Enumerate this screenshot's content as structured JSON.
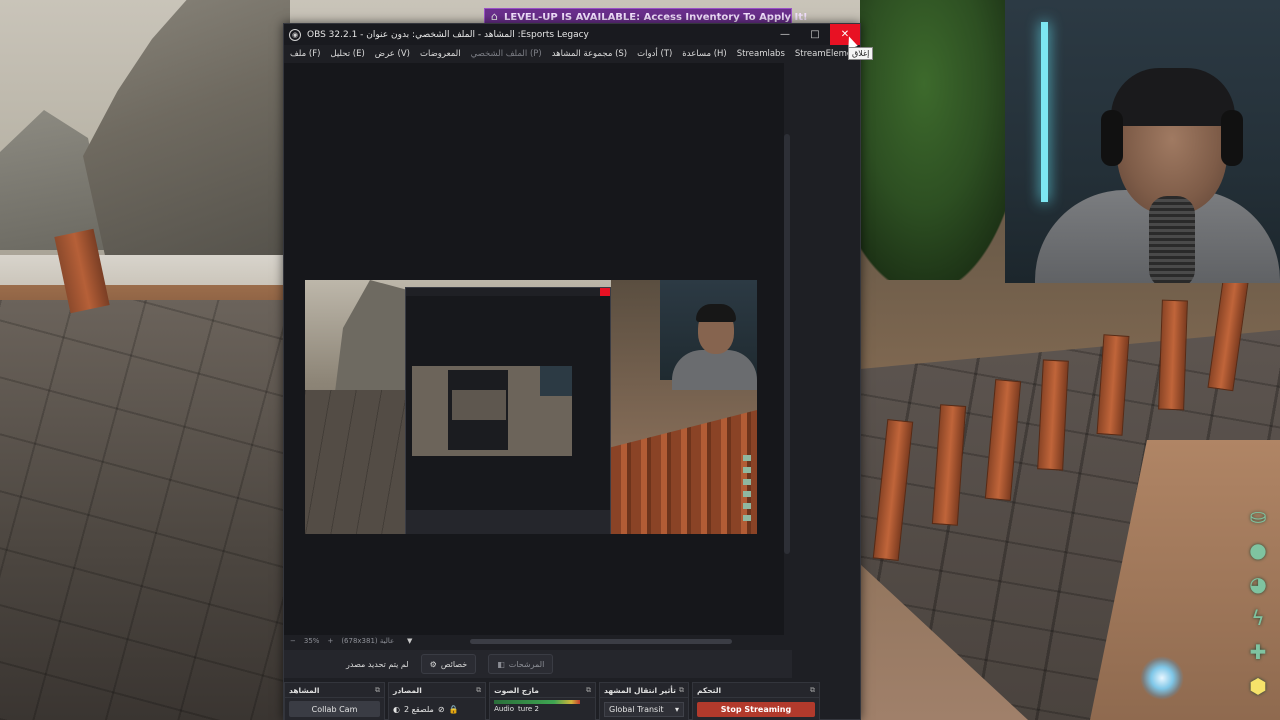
{
  "banner": {
    "text": "LEVEL-UP IS AVAILABLE: Access Inventory To Apply It!",
    "icon": "house-icon"
  },
  "window": {
    "title": "OBS 32.2.1 - المشاهد - الملف الشخصي: بدون عنوان :Esports Legacy",
    "min_glyph": "—",
    "max_glyph": "□",
    "close_glyph": "✕",
    "close_tooltip": "إغلاق"
  },
  "menu": {
    "items": [
      {
        "label": "ملف (F)",
        "enabled": true
      },
      {
        "label": "تحليل (E)",
        "enabled": true
      },
      {
        "label": "عرض (V)",
        "enabled": true
      },
      {
        "label": "المعروضات",
        "enabled": true
      },
      {
        "label": "الملف الشخصي (P)",
        "enabled": false
      },
      {
        "label": "مجموعة المشاهد (S)",
        "enabled": true
      },
      {
        "label": "أدوات (T)",
        "enabled": true
      },
      {
        "label": "مساعدة (H)",
        "enabled": true
      },
      {
        "label": "Streamlabs",
        "enabled": true
      },
      {
        "label": "StreamElements",
        "enabled": true
      }
    ]
  },
  "zoom": {
    "minus": "−",
    "value": "35%",
    "plus": "+",
    "canvas": "(678x381) عالية"
  },
  "transport": {
    "status_label": "لم يتم تحديد مصدر",
    "properties_label": "خصائص",
    "filters_label": "المرشحات"
  },
  "docks": {
    "scenes": {
      "title": "المشاهد",
      "item": "Collab Cam"
    },
    "sources": {
      "title": "المصادر",
      "item": "2 ملصقع"
    },
    "mixer": {
      "title": "مازج الصوت",
      "item": "Audio",
      "item2": "ture 2"
    },
    "transitions": {
      "title": "تأثير انتقال المشهد",
      "item": "Global Transit"
    },
    "controls": {
      "title": "التحكم",
      "stop_label": "Stop Streaming"
    }
  },
  "colors": {
    "accent_close": "#e81123",
    "stop_button": "#b23a2c",
    "banner": "#6a2f8c"
  }
}
